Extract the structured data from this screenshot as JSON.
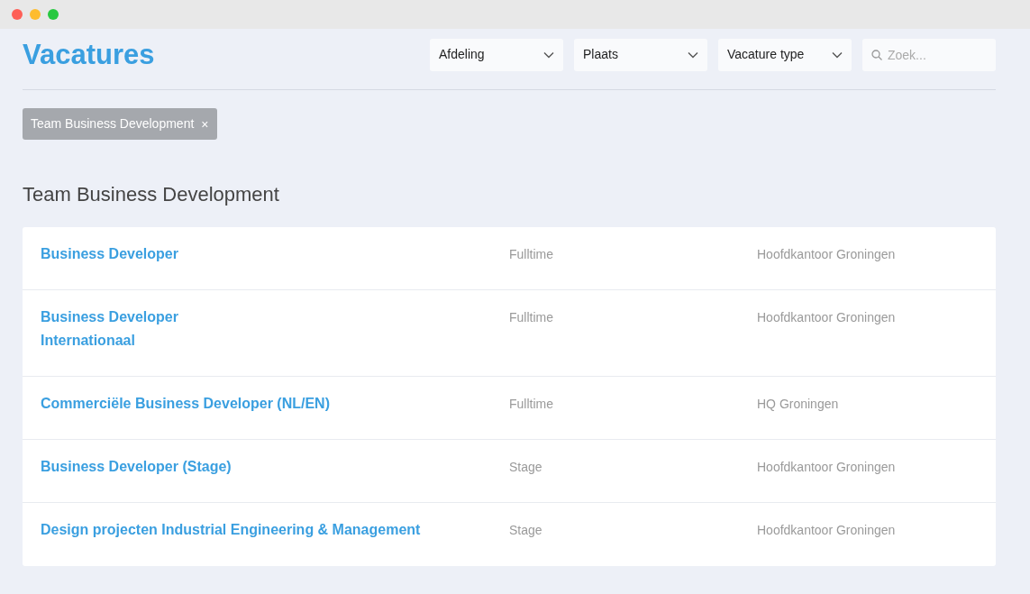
{
  "page_title": "Vacatures",
  "filters": [
    {
      "kind": "select",
      "label": "Afdeling"
    },
    {
      "kind": "select",
      "label": "Plaats"
    },
    {
      "kind": "select",
      "label": "Vacature type"
    },
    {
      "kind": "search",
      "placeholder": "Zoek..."
    }
  ],
  "active_tags": [
    {
      "label": "Team Business Development",
      "remove": "×"
    }
  ],
  "section_title": "Team Business Development",
  "jobs": [
    {
      "title": "Business Developer",
      "type": "Fulltime",
      "location": "Hoofdkantoor Groningen"
    },
    {
      "title": "Business Developer\nInternationaal",
      "type": "Fulltime",
      "location": "Hoofdkantoor Groningen"
    },
    {
      "title": "Commerciële Business Developer (NL/EN)",
      "type": "Fulltime",
      "location": "HQ Groningen"
    },
    {
      "title": "Business Developer (Stage)",
      "type": "Stage",
      "location": "Hoofdkantoor Groningen"
    },
    {
      "title": "Design projecten Industrial Engineering & Management",
      "type": "Stage",
      "location": "Hoofdkantoor Groningen"
    }
  ]
}
